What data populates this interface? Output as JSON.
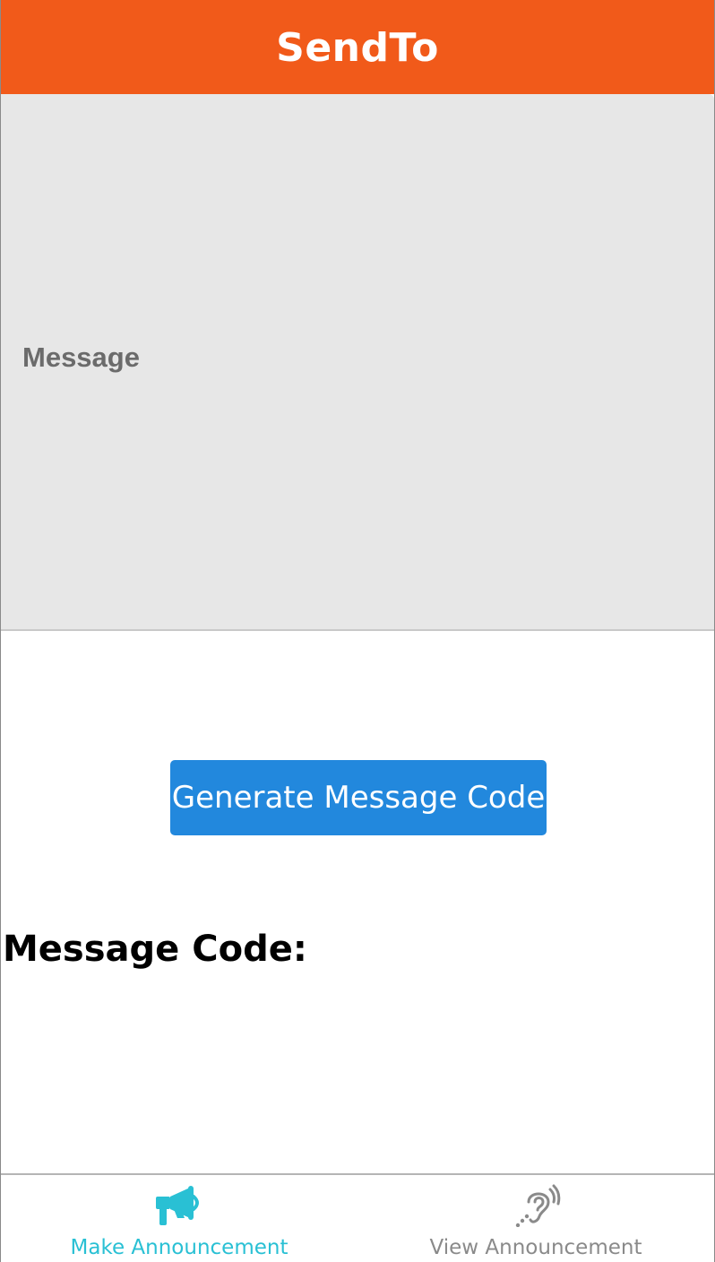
{
  "header": {
    "title": "SendTo"
  },
  "message": {
    "placeholder": "Message",
    "value": ""
  },
  "actions": {
    "generate_label": "Generate Message Code"
  },
  "result": {
    "code_label": "Message Code:"
  },
  "bottom_nav": {
    "items": [
      {
        "label": "Make Announcement",
        "icon": "megaphone-icon",
        "active": true
      },
      {
        "label": "View Announcement",
        "icon": "hearing-icon",
        "active": false
      }
    ]
  },
  "colors": {
    "header_bg": "#f15a1a",
    "button_bg": "#2288dd",
    "active_tab": "#29c0d4",
    "inactive_tab": "#8a8a8a"
  }
}
